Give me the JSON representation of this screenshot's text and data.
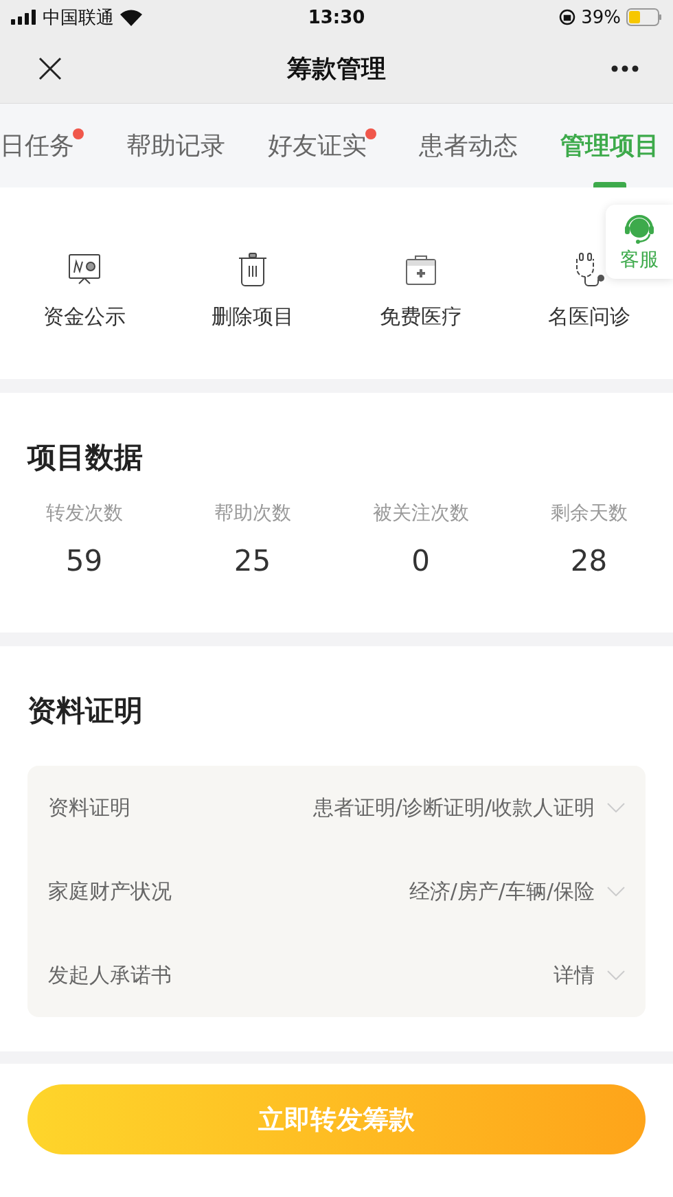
{
  "status_bar": {
    "carrier": "中国联通",
    "time": "13:30",
    "battery": "39%"
  },
  "nav": {
    "title": "筹款管理"
  },
  "tabs": [
    {
      "label": "日任务",
      "selected": false,
      "dot": true
    },
    {
      "label": "帮助记录",
      "selected": false,
      "dot": false
    },
    {
      "label": "好友证实",
      "selected": false,
      "dot": true
    },
    {
      "label": "患者动态",
      "selected": false,
      "dot": false
    },
    {
      "label": "管理项目",
      "selected": true,
      "dot": false
    }
  ],
  "tools": [
    {
      "label": "资金公示",
      "kind": "board"
    },
    {
      "label": "删除项目",
      "kind": "trash"
    },
    {
      "label": "免费医疗",
      "kind": "kit"
    },
    {
      "label": "名医问诊",
      "kind": "stethoscope"
    }
  ],
  "service": {
    "label": "客服"
  },
  "stats": {
    "title": "项目数据",
    "items": [
      {
        "label": "转发次数",
        "value": "59"
      },
      {
        "label": "帮助次数",
        "value": "25"
      },
      {
        "label": "被关注次数",
        "value": "0"
      },
      {
        "label": "剩余天数",
        "value": "28"
      }
    ]
  },
  "documents": {
    "title": "资料证明",
    "rows": [
      {
        "label": "资料证明",
        "value": "患者证明/诊断证明/收款人证明"
      },
      {
        "label": "家庭财产状况",
        "value": "经济/房产/车辆/保险"
      },
      {
        "label": "发起人承诺书",
        "value": "详情"
      }
    ]
  },
  "action": {
    "label": "立即转发筹款"
  }
}
